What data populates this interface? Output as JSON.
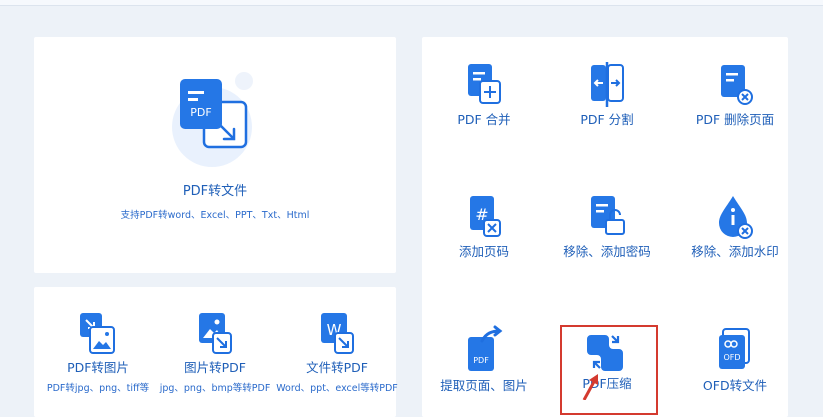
{
  "hero": {
    "icon": "pdf-to-document-icon",
    "icon_text": "PDF",
    "title": "PDF转文件",
    "subtitle": "支持PDF转word、Excel、PPT、Txt、Html"
  },
  "bottom_tools": [
    {
      "label": "PDF转图片",
      "desc": "PDF转jpg、png、tiff等",
      "icon": "pdf-to-image-icon"
    },
    {
      "label": "图片转PDF",
      "desc": "jpg、png、bmp等转PDF",
      "icon": "image-to-pdf-icon"
    },
    {
      "label": "文件转PDF",
      "desc": "Word、ppt、excel等转PDF",
      "icon": "word-to-pdf-icon",
      "icon_text": "W"
    }
  ],
  "grid_tools": [
    {
      "label": "PDF 合并",
      "icon": "pdf-merge-icon"
    },
    {
      "label": "PDF 分割",
      "icon": "pdf-split-icon"
    },
    {
      "label": "PDF 删除页面",
      "icon": "pdf-delete-page-icon"
    },
    {
      "label": "添加页码",
      "icon": "add-page-number-icon",
      "icon_text": "#"
    },
    {
      "label": "移除、添加密码",
      "icon": "password-lock-icon"
    },
    {
      "label": "移除、添加水印",
      "icon": "watermark-drop-icon"
    },
    {
      "label": "提取页面、图片",
      "icon": "extract-pages-icon",
      "icon_text": "PDF"
    },
    {
      "label": "PDF压缩",
      "icon": "pdf-compress-icon"
    },
    {
      "label": "OFD转文件",
      "icon": "ofd-convert-icon",
      "icon_text": "OFD"
    }
  ],
  "colors": {
    "primary": "#1f6fe0",
    "light": "#e9f1fd",
    "highlight": "#d43a2f",
    "background": "#edf2f8"
  }
}
